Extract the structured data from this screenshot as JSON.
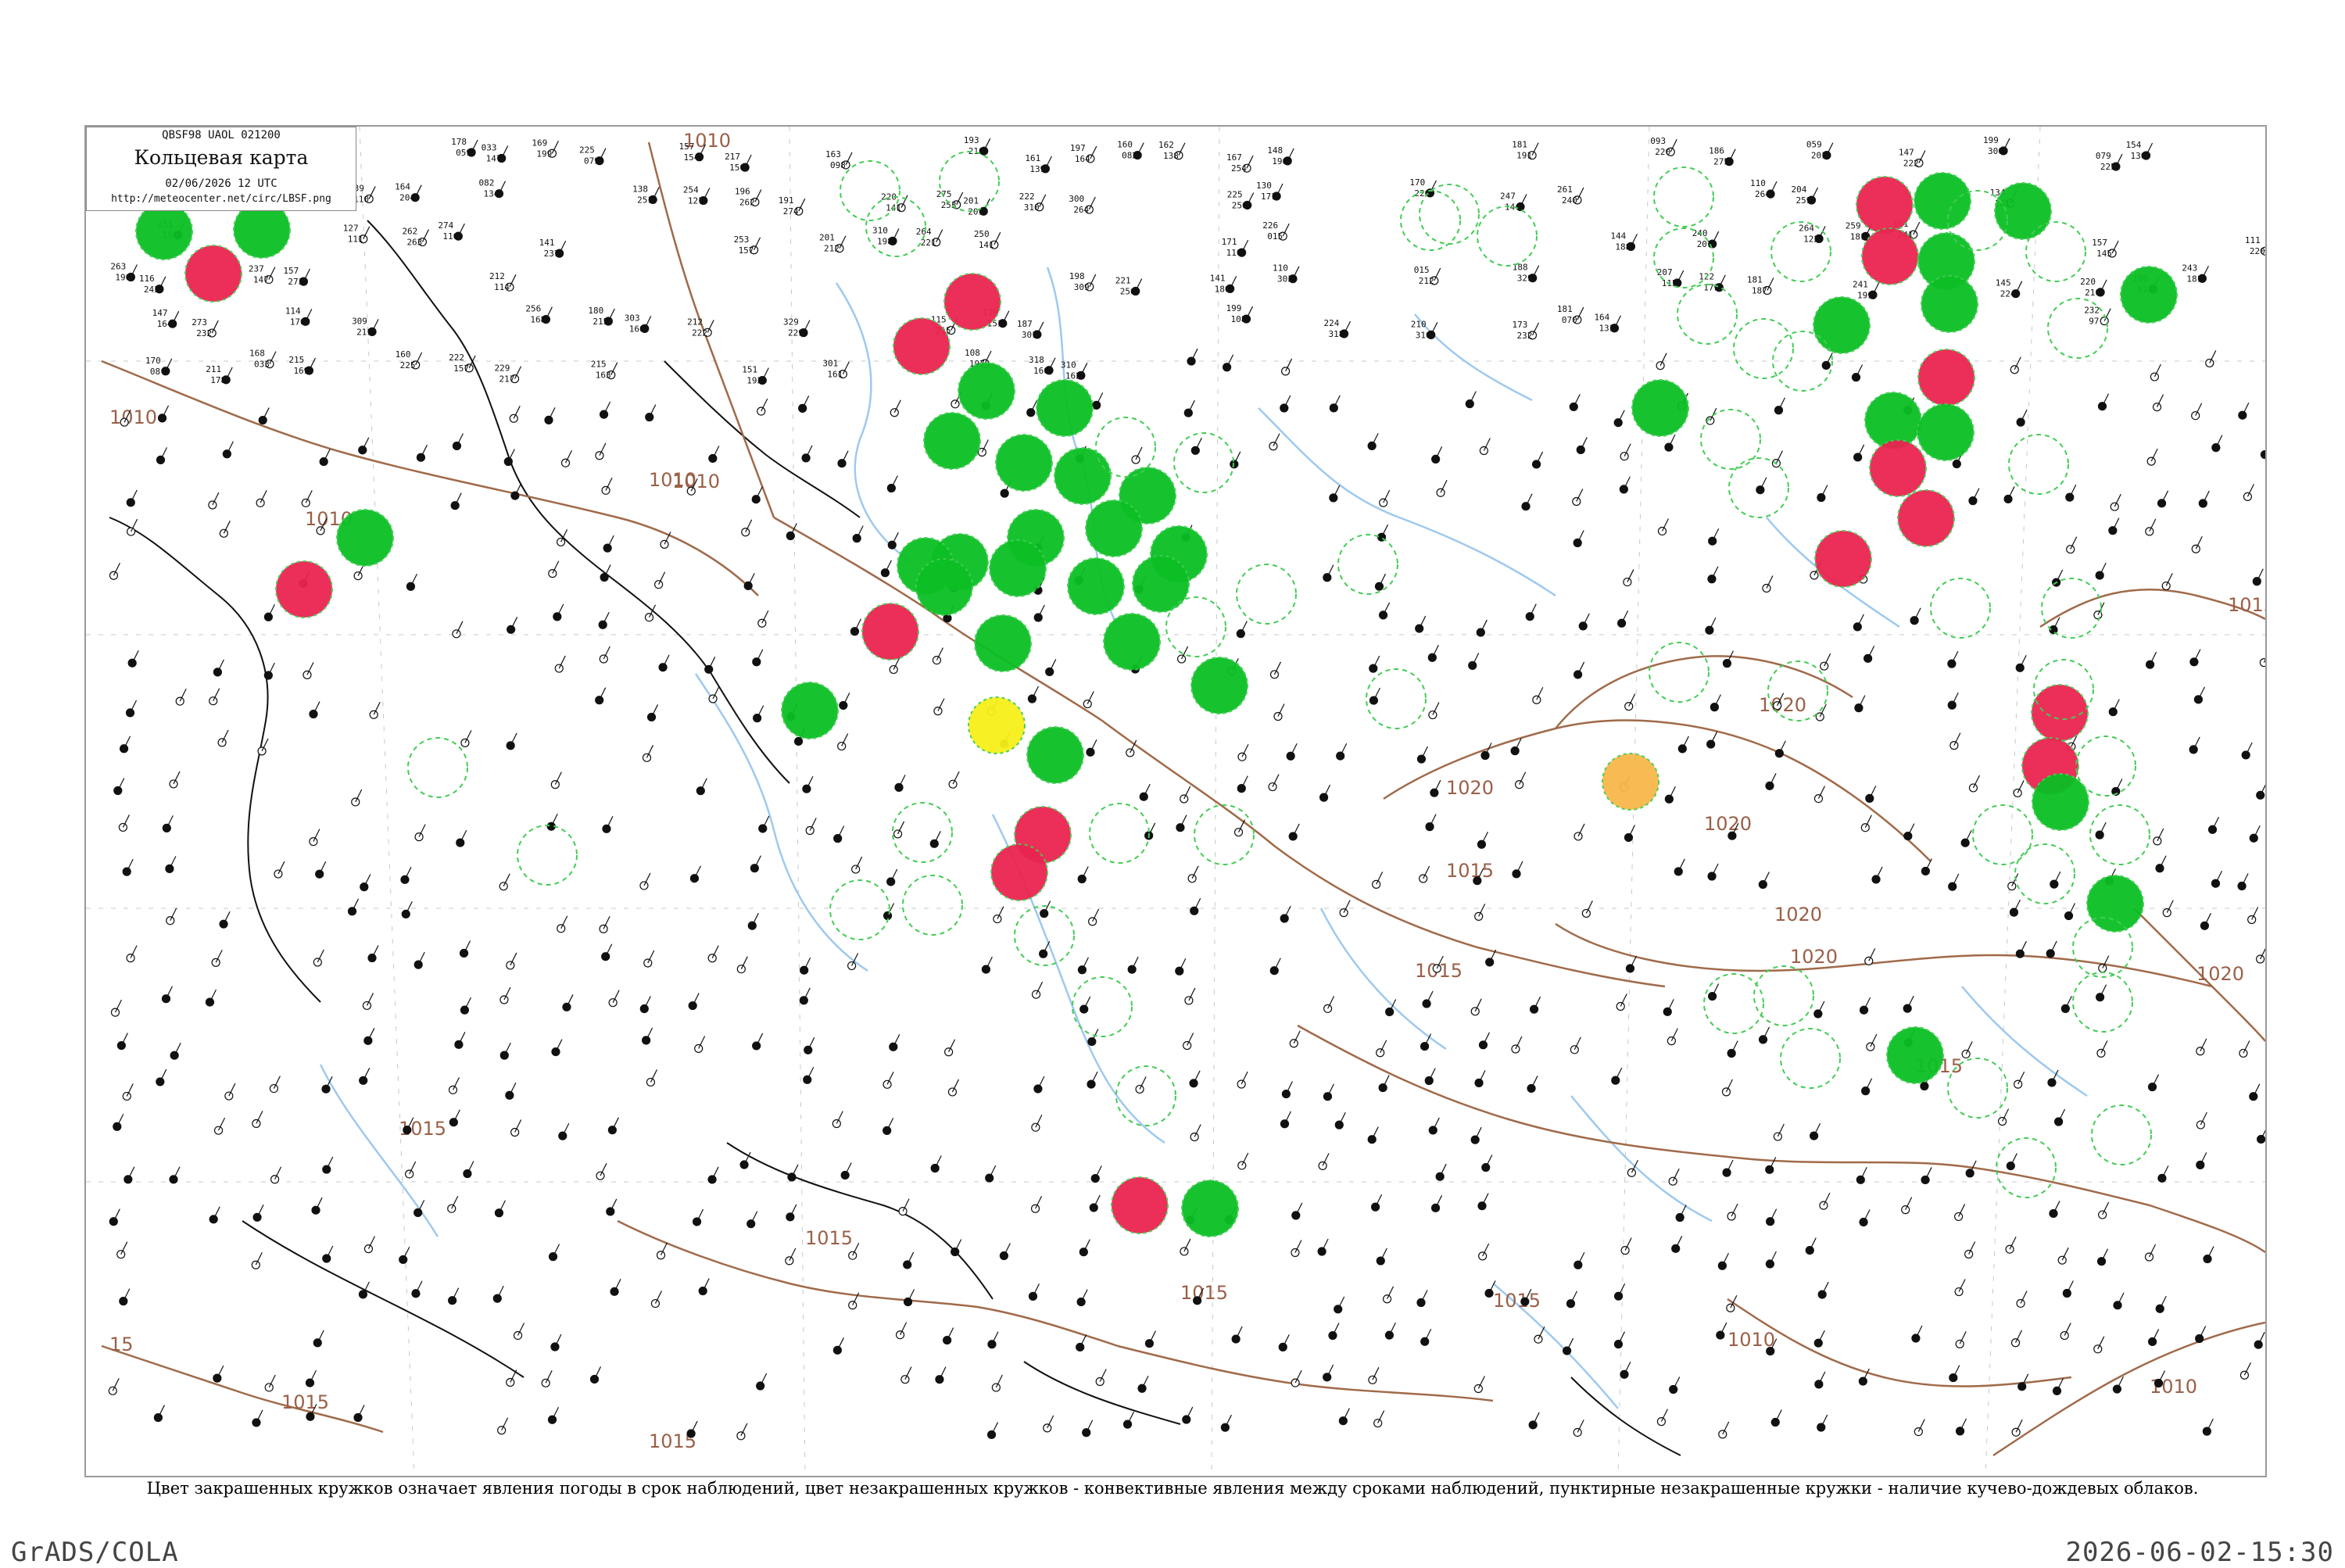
{
  "header": {
    "code": "QBSF98  UAOL  021200",
    "title": "Кольцевая карта",
    "date": "02/06/2026 12 UTC",
    "url": "http://meteocenter.net/circ/LBSF.png"
  },
  "caption": "Цвет закрашенных кружков означает явления погоды в срок наблюдений, цвет незакрашенных кружков - конвективные явления между сроками наблюдений, пунктирные незакрашенные кружки - наличие кучево-дождевых облаков.",
  "footer": {
    "left": "GrADS/COLA",
    "right": "2026-06-02-15:30"
  },
  "colors": {
    "green_phenomena": "#0bbf24",
    "red_phenomena": "#ea2450",
    "yellow_phenomena": "#f7f01a",
    "orange_phenomena": "#f8b84a",
    "cb_dashed": "#44cc55",
    "isobar": "#a06a4a",
    "rivers": "#9ec9ef",
    "coast": "#000000"
  },
  "isobar_labels": [
    "1010",
    "1010",
    "1010",
    "1010",
    "1015",
    "1015",
    "1020",
    "1020",
    "1020",
    "1020",
    "1020",
    "1015",
    "1015",
    "1015",
    "1015",
    "1015",
    "1010",
    "1010",
    "15",
    "1015",
    "1010",
    "1015",
    "1015",
    "1020"
  ],
  "station_values": [
    "232",
    "070",
    "131",
    "97",
    "08",
    "178",
    "033",
    "169",
    "225",
    "157",
    "217",
    "163",
    "193",
    "161",
    "197",
    "160",
    "162",
    "167",
    "148",
    "181",
    "093",
    "186",
    "059",
    "147",
    "199",
    "079",
    "154",
    "150",
    "098",
    "210",
    "139",
    "164",
    "082",
    "138",
    "254",
    "196",
    "191",
    "220",
    "275",
    "201",
    "222",
    "300",
    "225",
    "130",
    "170",
    "247",
    "261",
    "110",
    "204",
    "134",
    "251",
    "127",
    "262",
    "274",
    "141",
    "253",
    "201",
    "310",
    "264",
    "250",
    "171",
    "226",
    "144",
    "240",
    "264",
    "259",
    "161",
    "157",
    "111",
    "263",
    "116",
    "237",
    "157",
    "212",
    "198",
    "221",
    "141",
    "110",
    "015",
    "188",
    "207",
    "122",
    "181",
    "241",
    "145",
    "220",
    "190",
    "243",
    "147",
    "273",
    "114",
    "309",
    "256",
    "180",
    "303",
    "212",
    "329",
    "115",
    "179",
    "187",
    "199",
    "224",
    "210",
    "173",
    "181",
    "164",
    "232",
    "170",
    "211",
    "168",
    "215",
    "160",
    "222",
    "229",
    "215",
    "151",
    "301",
    "108",
    "318",
    "310"
  ]
}
